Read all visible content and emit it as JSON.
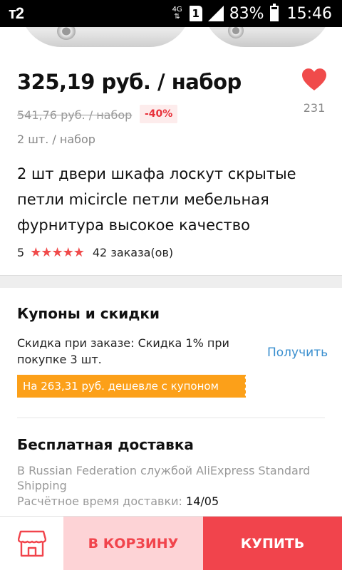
{
  "status_bar": {
    "carrier": "т2",
    "network": "4G",
    "sim_slot": "1",
    "battery": "83%",
    "battery_level": 0.83,
    "time": "15:46"
  },
  "product": {
    "price": "325,19 руб. / набор",
    "old_price": "541,76 руб. / набор",
    "discount": "-40%",
    "unit": "2 шт. / набор",
    "title": "2 шт двери шкафа лоскут скрытые петли micircle петли мебельная фурнитура высокое качество",
    "rating": "5",
    "stars": "★★★★★",
    "orders": "42 заказа(ов)",
    "wishlist_count": "231"
  },
  "coupons": {
    "title": "Купоны и скидки",
    "order_discount": "Скидка при заказе: Скидка 1% при покупке 3 шт.",
    "get_label": "Получить",
    "coupon_banner": "На 263,31 руб. дешевле с купоном"
  },
  "shipping": {
    "title": "Бесплатная доставка",
    "method": "В Russian Federation службой AliExpress Standard Shipping",
    "eta_label": "Расчётное время доставки:",
    "eta_date": "14/05"
  },
  "bottom_bar": {
    "cart_label": "В КОРЗИНУ",
    "buy_label": "КУПИТЬ"
  },
  "colors": {
    "accent": "#f1444c",
    "cart_bg": "#fdd3d6",
    "coupon_orange": "#fca019",
    "link_blue": "#3a8fcf",
    "heart_red": "#f04b4b"
  },
  "icons": {
    "favorite": "heart-icon",
    "store": "store-icon",
    "rating": "star-icon"
  }
}
